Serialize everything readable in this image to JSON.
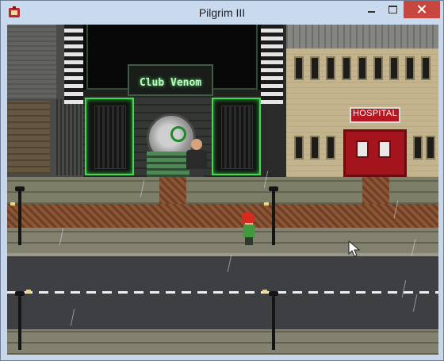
{
  "window": {
    "title": "Pilgrim III",
    "controls": [
      "minimize",
      "maximize",
      "close"
    ]
  },
  "scene": {
    "club_sign": "Club Venom",
    "hospital_sign": "HOSPITAL"
  },
  "icons": {
    "app": "app-icon",
    "cursor": "mouse-cursor-icon"
  },
  "colors": {
    "neon": "#43d952",
    "hospital_red": "#b5191f",
    "close_button": "#c7463f",
    "road": "#3e3f43"
  }
}
